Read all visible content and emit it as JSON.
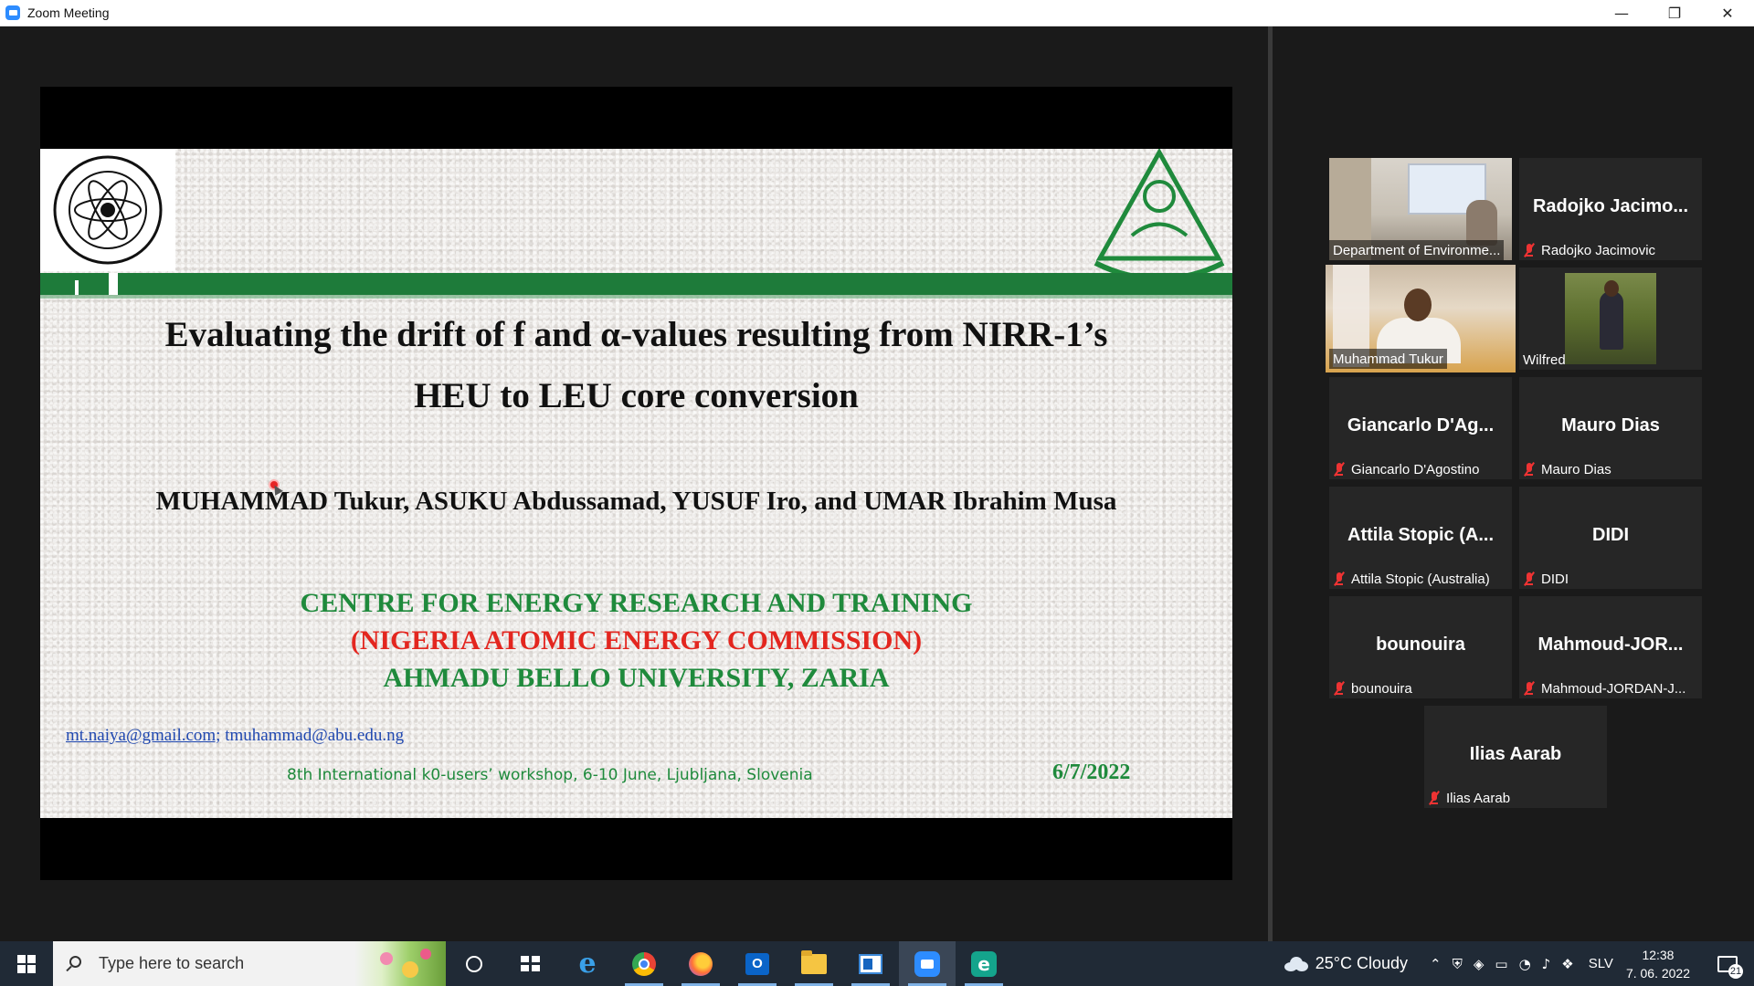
{
  "window": {
    "title": "Zoom Meeting",
    "controls": {
      "minimize": "—",
      "restore": "❐",
      "close": "✕"
    }
  },
  "slide": {
    "title_line1": "Evaluating the drift of f and α-values resulting from NIRR-1’s",
    "title_line2": "HEU to LEU core conversion",
    "authors": "MUHAMMAD Tukur, ASUKU Abdussamad, YUSUF Iro, and UMAR Ibrahim Musa",
    "institution_line1": "CENTRE FOR ENERGY RESEARCH AND TRAINING",
    "institution_line2": "(NIGERIA ATOMIC ENERGY COMMISSION)",
    "institution_line3": "AHMADU BELLO UNIVERSITY, ZARIA",
    "email_link": "mt.naiya@gmail.com;",
    "email_plain": " tmuhammad@abu.edu.ng",
    "workshop": "8th International k0-users’ workshop, 6-10 June, Ljubljana, Slovenia",
    "date": "6/7/2022",
    "colors": {
      "green": "#1f8a3c",
      "red": "#e3261f",
      "bar": "#1e7b3a"
    }
  },
  "participants": [
    {
      "big_name": "",
      "caption": "Department of Environme...",
      "video": true,
      "muted": false
    },
    {
      "big_name": "Radojko  Jacimo...",
      "caption": "Radojko Jacimovic",
      "video": false,
      "muted": true
    },
    {
      "big_name": "",
      "caption": "Muhammad Tukur",
      "video": true,
      "muted": false,
      "active_speaker": true
    },
    {
      "big_name": "",
      "caption": "Wilfred",
      "video": true,
      "muted": false
    },
    {
      "big_name": "Giancarlo  D'Ag...",
      "caption": "Giancarlo D'Agostino",
      "video": false,
      "muted": true
    },
    {
      "big_name": "Mauro Dias",
      "caption": "Mauro Dias",
      "video": false,
      "muted": true
    },
    {
      "big_name": "Attila  Stopic  (A...",
      "caption": "Attila Stopic (Australia)",
      "video": false,
      "muted": true
    },
    {
      "big_name": "DIDI",
      "caption": "DIDI",
      "video": false,
      "muted": true
    },
    {
      "big_name": "bounouira",
      "caption": "bounouira",
      "video": false,
      "muted": true
    },
    {
      "big_name": "Mahmoud-JOR...",
      "caption": "Mahmoud-JORDAN-J...",
      "video": false,
      "muted": true
    },
    {
      "big_name": "Ilias Aarab",
      "caption": "Ilias Aarab",
      "video": false,
      "muted": true
    }
  ],
  "taskbar": {
    "search_placeholder": "Type here to search",
    "apps": [
      "cortana-icon",
      "task-view-icon",
      "internet-explorer-icon",
      "chrome-icon",
      "firefox-icon",
      "outlook-icon",
      "file-explorer-icon",
      "slides-app-icon",
      "zoom-icon",
      "edge-icon"
    ],
    "weather": "25°C  Cloudy",
    "language": "SLV",
    "time": "12:38",
    "date": "7. 06. 2022",
    "notification_count": "21"
  }
}
